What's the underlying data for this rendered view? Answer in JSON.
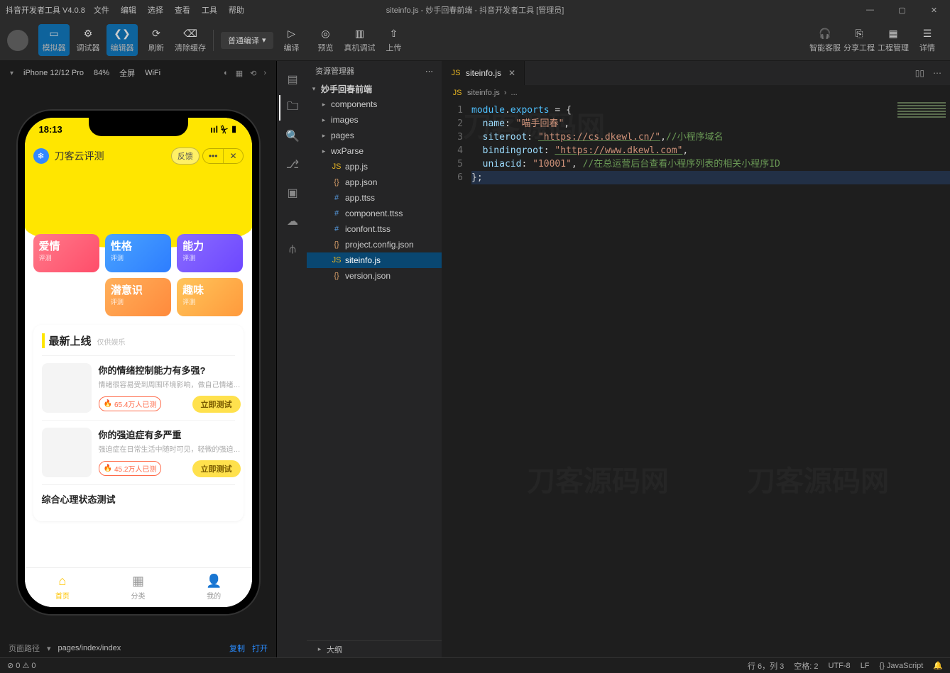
{
  "titlebar": {
    "app": "抖音开发者工具 V4.0.8",
    "menus": [
      "文件",
      "编辑",
      "选择",
      "查看",
      "工具",
      "帮助"
    ],
    "center": "siteinfo.js - 妙手回春前端 - 抖音开发者工具 [管理员]"
  },
  "toolbar": {
    "items": [
      "模拟器",
      "调试器",
      "编辑器",
      "刷新",
      "清除缓存"
    ],
    "compile_mode": "普通编译",
    "right_items": [
      "编译",
      "预览",
      "真机调试",
      "上传"
    ],
    "far_items": [
      "智能客服",
      "分享工程",
      "工程管理",
      "详情"
    ]
  },
  "sim": {
    "device": "iPhone 12/12 Pro",
    "zoom": "84%",
    "screen": "全屏",
    "net": "WiFi",
    "time": "18:13",
    "mini_title": "刀客云评测",
    "feedback": "反馈",
    "cats": [
      {
        "t": "爱情",
        "s": "评测"
      },
      {
        "t": "性格",
        "s": "评测"
      },
      {
        "t": "能力",
        "s": "评测"
      },
      {
        "t": "潜意识",
        "s": "评测"
      },
      {
        "t": "趣味",
        "s": "评测"
      }
    ],
    "section_title": "最新上线",
    "section_sub": "仅供娱乐",
    "cards": [
      {
        "title": "你的情绪控制能力有多强?",
        "desc": "情绪很容易受到周围环境影响，做自己情绪…",
        "badge": "65.4万人已测",
        "btn": "立即测试"
      },
      {
        "title": "你的强迫症有多严重",
        "desc": "强迫症在日常生活中随时可见，轻微的强迫…",
        "badge": "45.2万人已测",
        "btn": "立即测试"
      },
      {
        "title": "综合心理状态测试",
        "desc": "",
        "badge": "",
        "btn": ""
      }
    ],
    "tabs": [
      {
        "label": "首页",
        "icon": "⌂"
      },
      {
        "label": "分类",
        "icon": "▦"
      },
      {
        "label": "我的",
        "icon": "👤"
      }
    ],
    "foot": {
      "label": "页面路径",
      "path": "pages/index/index",
      "copy": "复制",
      "open": "打开"
    }
  },
  "explorer": {
    "title": "资源管理器",
    "root": "妙手回春前端",
    "folders": [
      "components",
      "images",
      "pages",
      "wxParse"
    ],
    "files": [
      {
        "name": "app.js",
        "cls": "fi-js",
        "pre": "JS"
      },
      {
        "name": "app.json",
        "cls": "fi-json",
        "pre": "{}"
      },
      {
        "name": "app.ttss",
        "cls": "fi-hash",
        "pre": "#"
      },
      {
        "name": "component.ttss",
        "cls": "fi-hash",
        "pre": "#"
      },
      {
        "name": "iconfont.ttss",
        "cls": "fi-hash",
        "pre": "#"
      },
      {
        "name": "project.config.json",
        "cls": "fi-json",
        "pre": "{}"
      },
      {
        "name": "siteinfo.js",
        "cls": "fi-js",
        "pre": "JS",
        "sel": true
      },
      {
        "name": "version.json",
        "cls": "fi-json",
        "pre": "{}"
      }
    ],
    "outline": "大纲"
  },
  "editor": {
    "tab": "siteinfo.js",
    "breadcrumb": [
      "siteinfo.js",
      "..."
    ],
    "code": {
      "kw_module": "module",
      "kw_exports": "exports",
      "p_name": "name",
      "v_name": "\"喵手回春\"",
      "p_siteroot": "siteroot",
      "v_siteroot": "\"https://cs.dkewl.cn/\"",
      "c_siteroot": "//小程序域名",
      "p_bindingroot": "bindingroot",
      "v_bindingroot": "\"https://www.dkewl.com\"",
      "p_uniacid": "uniacid",
      "v_uniacid": "\"10001\"",
      "c_uniacid": "//在总运营后台查看小程序列表的相关小程序ID"
    }
  },
  "status": {
    "err": "⊘ 0 ⚠ 0",
    "line": "行 6，列 3",
    "spaces": "空格: 2",
    "enc": "UTF-8",
    "eol": "LF",
    "lang": "{} JavaScript"
  }
}
